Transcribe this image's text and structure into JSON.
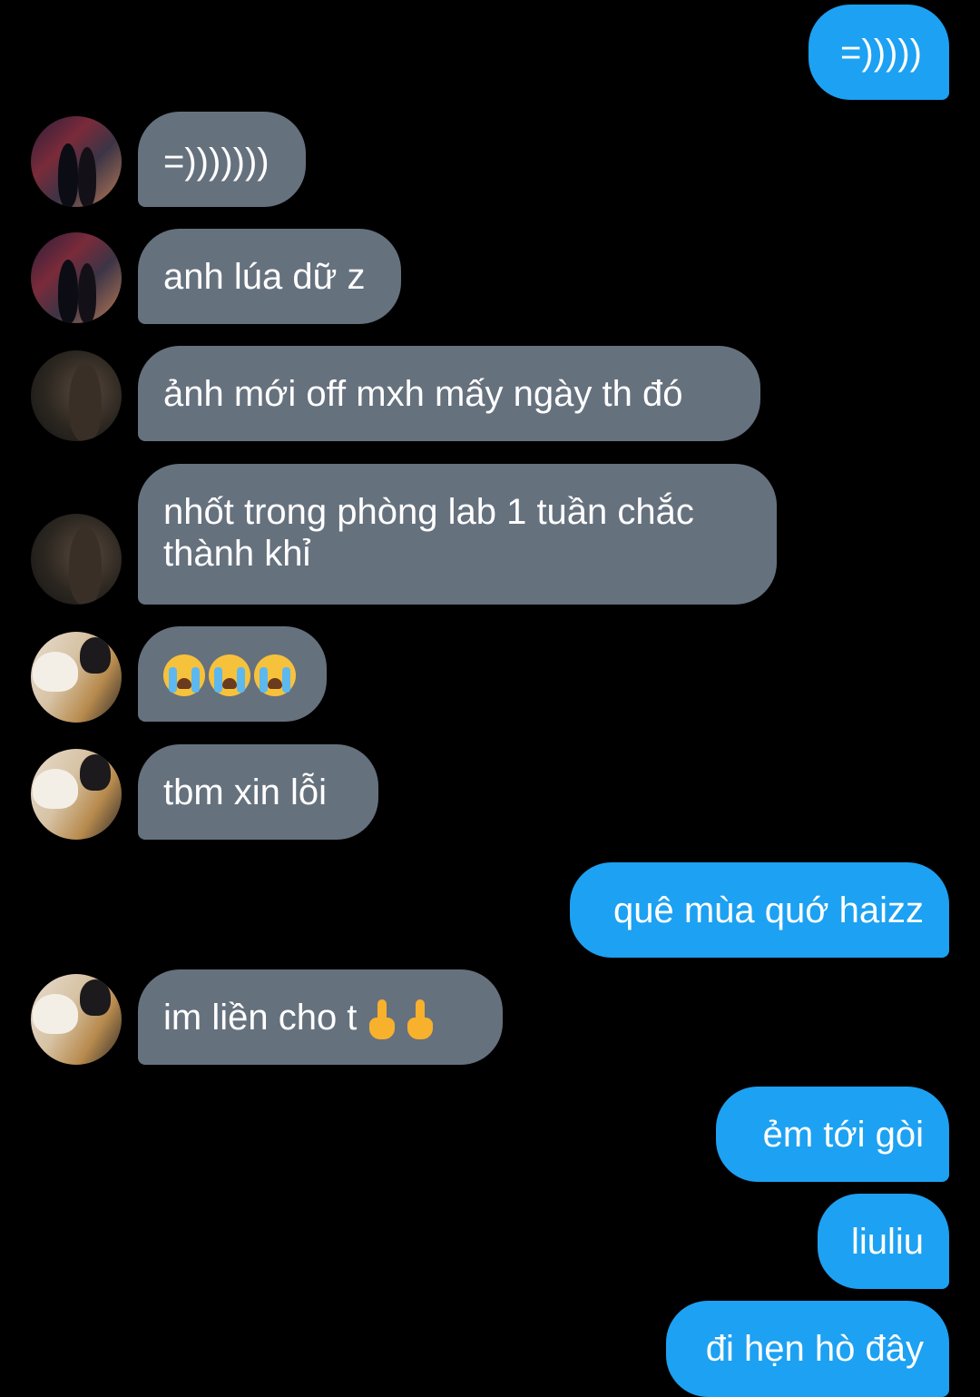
{
  "conversation": {
    "messages": [
      {
        "direction": "sent",
        "text": "=)))))"
      },
      {
        "direction": "received",
        "sender_avatar": "avatar-concert-photo",
        "text": "=)))))))"
      },
      {
        "direction": "received",
        "sender_avatar": "avatar-concert-photo",
        "text": "anh lúa dữ z"
      },
      {
        "direction": "received",
        "sender_avatar": "avatar-dark-photo",
        "text": "ảnh mới off mxh mấy ngày th đó"
      },
      {
        "direction": "received",
        "sender_avatar": "avatar-dark-photo",
        "text_line1": "nhốt trong phòng lab 1 tuần chắc",
        "text_line2": "thành khỉ"
      },
      {
        "direction": "received",
        "sender_avatar": "avatar-dog-photo",
        "emoji": [
          "loudly-crying-face-emoji",
          "loudly-crying-face-emoji",
          "loudly-crying-face-emoji"
        ]
      },
      {
        "direction": "received",
        "sender_avatar": "avatar-dog-photo",
        "text": "tbm xin lỗi"
      },
      {
        "direction": "sent",
        "text": "quê mùa quớ haizz"
      },
      {
        "direction": "received",
        "sender_avatar": "avatar-dog-photo",
        "text": "im liền cho t",
        "emoji": [
          "middle-finger-emoji",
          "middle-finger-emoji"
        ]
      },
      {
        "direction": "sent",
        "text": "ẻm tới gòi"
      },
      {
        "direction": "sent",
        "text": "liuliu"
      },
      {
        "direction": "sent",
        "text": "đi hẹn hò đây"
      }
    ]
  },
  "colors": {
    "background": "#000000",
    "sent_bubble": "#1da1f2",
    "received_bubble": "#66717e",
    "text": "#ffffff"
  }
}
